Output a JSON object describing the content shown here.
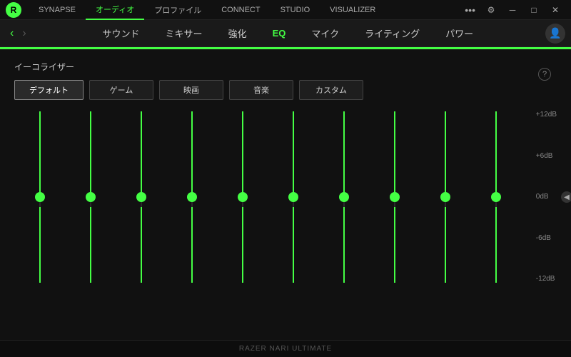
{
  "titlebar": {
    "nav_items": [
      {
        "label": "SYNAPSE",
        "active": false
      },
      {
        "label": "オーディオ",
        "active": true
      },
      {
        "label": "プロファイル",
        "active": false
      },
      {
        "label": "CONNECT",
        "active": false
      },
      {
        "label": "STUDIO",
        "active": false
      },
      {
        "label": "VISUALIZER",
        "active": false
      }
    ],
    "more_label": "•••",
    "gear_label": "⚙",
    "minimize_label": "─",
    "maximize_label": "□",
    "close_label": "✕"
  },
  "navbar": {
    "back_label": "‹",
    "forward_label": "›",
    "tabs": [
      {
        "label": "サウンド",
        "active": false
      },
      {
        "label": "ミキサー",
        "active": false
      },
      {
        "label": "強化",
        "active": false
      },
      {
        "label": "EQ",
        "active": true
      },
      {
        "label": "マイク",
        "active": false
      },
      {
        "label": "ライティング",
        "active": false
      },
      {
        "label": "パワー",
        "active": false
      }
    ]
  },
  "eq": {
    "title": "イーコライザー",
    "presets": [
      {
        "label": "デフォルト",
        "active": true
      },
      {
        "label": "ゲーム",
        "active": false
      },
      {
        "label": "映画",
        "active": false
      },
      {
        "label": "音楽",
        "active": false
      },
      {
        "label": "カスタム",
        "active": false
      }
    ],
    "db_labels": [
      "+12dB",
      "+6dB",
      "0dB",
      "-6dB",
      "-12dB"
    ],
    "sliders": [
      {
        "position_pct": 50
      },
      {
        "position_pct": 50
      },
      {
        "position_pct": 50
      },
      {
        "position_pct": 50
      },
      {
        "position_pct": 50
      },
      {
        "position_pct": 50
      },
      {
        "position_pct": 50
      },
      {
        "position_pct": 50
      },
      {
        "position_pct": 50
      },
      {
        "position_pct": 50
      }
    ],
    "help_label": "?"
  },
  "footer": {
    "device_label": "RAZER NARI ULTIMATE"
  }
}
